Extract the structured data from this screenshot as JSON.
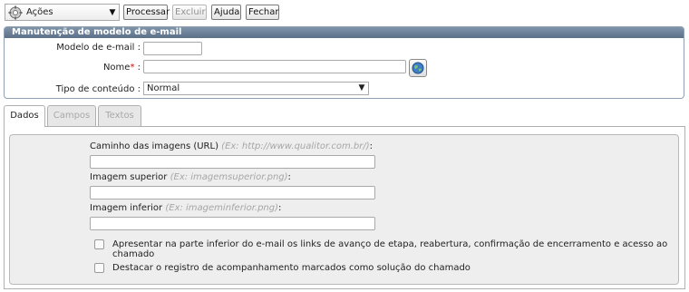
{
  "toolbar": {
    "actions_label": "Ações",
    "process_label": "Processar",
    "delete_label": "Excluir",
    "help_label": "Ajuda",
    "close_label": "Fechar"
  },
  "form": {
    "title": "Manutenção de modelo de e-mail",
    "email_model_label": "Modelo de e-mail :",
    "email_model_value": "",
    "name_label": "Nome",
    "required_mark": "*",
    "name_suffix": " :",
    "name_value": "",
    "content_type_label": "Tipo de conteúdo :",
    "content_type_value": "Normal"
  },
  "tabs": [
    {
      "label": "Dados",
      "active": true
    },
    {
      "label": "Campos",
      "active": false
    },
    {
      "label": "Textos",
      "active": false
    }
  ],
  "data_tab": {
    "images_path_label": "Caminho das imagens (URL)",
    "images_path_hint": "(Ex: http://www.qualitor.com.br/)",
    "images_path_suffix": ":",
    "top_image_label": "Imagem superior",
    "top_image_hint": "(Ex: imagemsuperior.png)",
    "top_image_suffix": ":",
    "bottom_image_label": "Imagem inferior",
    "bottom_image_hint": "(Ex: imageminferior.png)",
    "bottom_image_suffix": ":",
    "checkbox_links_label": "Apresentar na parte inferior do e-mail os links de avanço de etapa, reabertura, confirmação de encerramento e acesso ao chamado",
    "checkbox_links_checked": false,
    "checkbox_highlight_label": "Destacar o registro de acompanhamento marcados como solução do chamado",
    "checkbox_highlight_checked": false
  },
  "icons": {
    "actions": "gear-icon",
    "dropdown": "chevron-down-icon",
    "lookup": "globe-icon"
  }
}
